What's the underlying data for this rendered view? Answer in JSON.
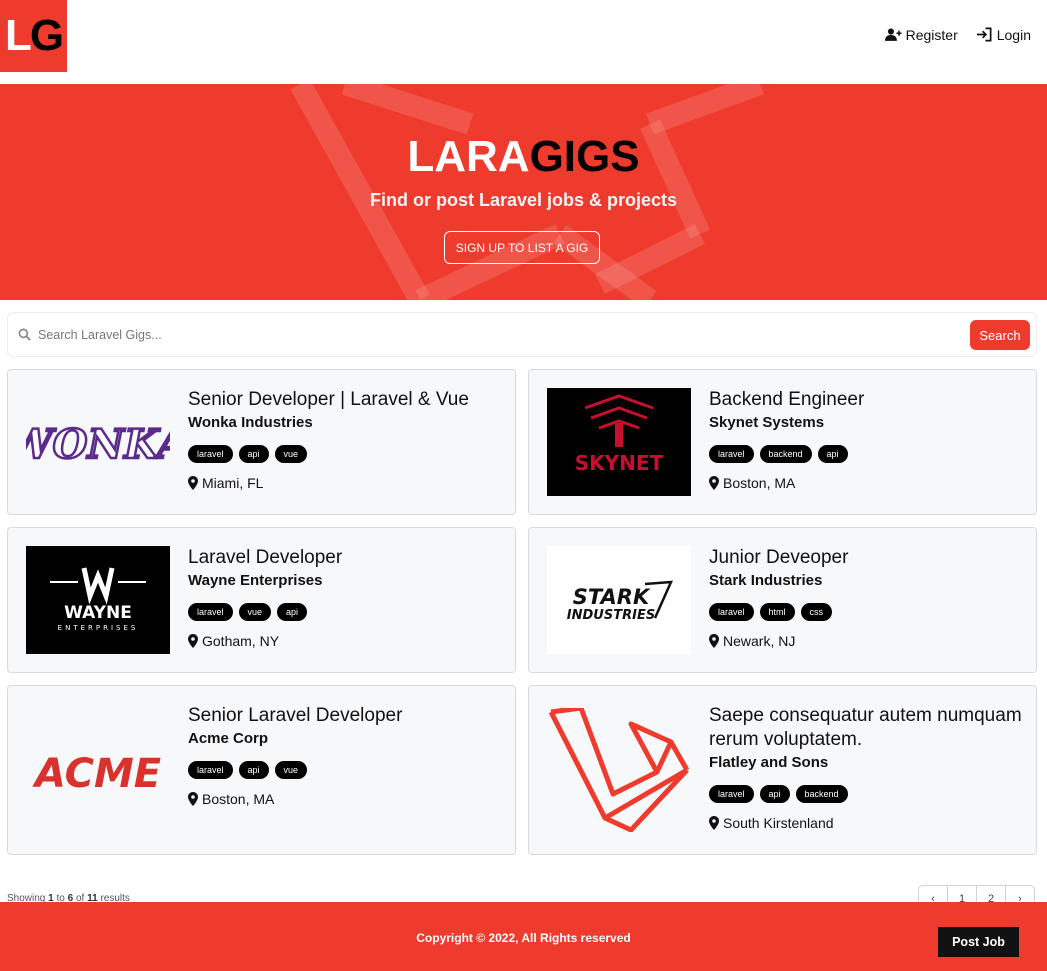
{
  "brand": {
    "logo_text_1": "L",
    "logo_text_2": "G",
    "accent": "#ef3b2d"
  },
  "nav": {
    "register_label": "Register",
    "login_label": "Login"
  },
  "hero": {
    "title_part1": "LARA",
    "title_part2": "GIGS",
    "subtitle": "Find or post Laravel jobs & projects",
    "cta_label": "SIGN UP TO LIST A GIG"
  },
  "search": {
    "placeholder": "Search Laravel Gigs...",
    "button_label": "Search"
  },
  "listings": [
    {
      "title": "Senior Developer | Laravel & Vue",
      "company": "Wonka Industries",
      "tags": [
        "laravel",
        "api",
        "vue"
      ],
      "location": "Miami, FL",
      "logo": "WONKA"
    },
    {
      "title": "Backend Engineer",
      "company": "Skynet Systems",
      "tags": [
        "laravel",
        "backend",
        "api"
      ],
      "location": "Boston, MA",
      "logo": "SKYNET"
    },
    {
      "title": "Laravel Developer",
      "company": "Wayne Enterprises",
      "tags": [
        "laravel",
        "vue",
        "api"
      ],
      "location": "Gotham, NY",
      "logo": "WAYNE"
    },
    {
      "title": "Junior Deveoper",
      "company": "Stark Industries",
      "tags": [
        "laravel",
        "html",
        "css"
      ],
      "location": "Newark, NJ",
      "logo": "STARK INDUSTRIES"
    },
    {
      "title": "Senior Laravel Developer",
      "company": "Acme Corp",
      "tags": [
        "laravel",
        "api",
        "vue"
      ],
      "location": "Boston, MA",
      "logo": "ACME"
    },
    {
      "title": "Saepe consequatur autem numquam rerum voluptatem.",
      "company": "Flatley and Sons",
      "tags": [
        "laravel",
        "api",
        "backend"
      ],
      "location": "South Kirstenland",
      "logo": "laravel-logo"
    }
  ],
  "pagination": {
    "showing_prefix": "Showing",
    "from": "1",
    "to_word": "to",
    "to": "6",
    "of_word": "of",
    "total": "11",
    "results_word": "results",
    "prev": "‹",
    "pages": [
      "1",
      "2"
    ],
    "next": "›"
  },
  "footer": {
    "copyright": "Copyright © 2022, All Rights reserved",
    "post_job_label": "Post Job"
  }
}
